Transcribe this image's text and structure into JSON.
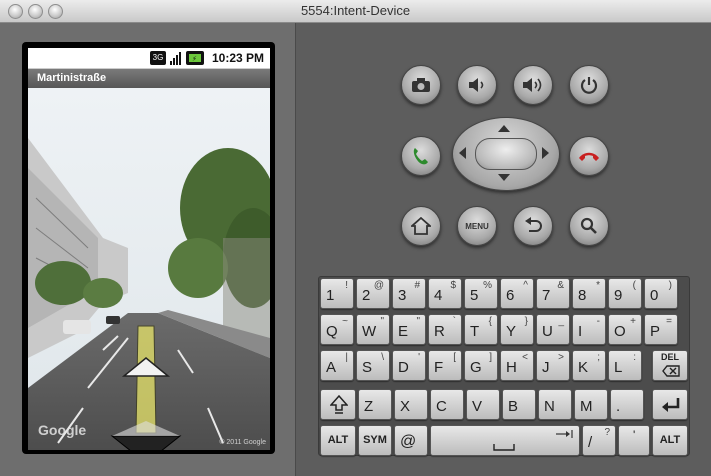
{
  "window": {
    "title": "5554:Intent-Device"
  },
  "phone": {
    "status": {
      "network": "3G",
      "time": "10:23 PM"
    },
    "app_title": "Martinistraße",
    "watermark": "Google",
    "copyright": "© 2011 Google"
  },
  "controls": {
    "menu_label": "MENU"
  },
  "keyboard": {
    "row1": [
      {
        "p": "1",
        "s": "!"
      },
      {
        "p": "2",
        "s": "@"
      },
      {
        "p": "3",
        "s": "#"
      },
      {
        "p": "4",
        "s": "$"
      },
      {
        "p": "5",
        "s": "%"
      },
      {
        "p": "6",
        "s": "^"
      },
      {
        "p": "7",
        "s": "&"
      },
      {
        "p": "8",
        "s": "*"
      },
      {
        "p": "9",
        "s": "("
      },
      {
        "p": "0",
        "s": ")"
      }
    ],
    "row2": [
      {
        "p": "Q",
        "s": "~"
      },
      {
        "p": "W",
        "s": "\""
      },
      {
        "p": "E",
        "s": "\""
      },
      {
        "p": "R",
        "s": "`"
      },
      {
        "p": "T",
        "s": "{"
      },
      {
        "p": "Y",
        "s": "}"
      },
      {
        "p": "U",
        "s": "_"
      },
      {
        "p": "I",
        "s": "-"
      },
      {
        "p": "O",
        "s": "+"
      },
      {
        "p": "P",
        "s": "="
      }
    ],
    "row3": [
      {
        "p": "A",
        "s": "|"
      },
      {
        "p": "S",
        "s": "\\"
      },
      {
        "p": "D",
        "s": "'"
      },
      {
        "p": "F",
        "s": "["
      },
      {
        "p": "G",
        "s": "]"
      },
      {
        "p": "H",
        "s": "<"
      },
      {
        "p": "J",
        "s": ">"
      },
      {
        "p": "K",
        "s": ";"
      },
      {
        "p": "L",
        "s": ":"
      }
    ],
    "del_label": "DEL",
    "row4": [
      {
        "p": "Z",
        "s": ""
      },
      {
        "p": "X",
        "s": ""
      },
      {
        "p": "C",
        "s": ""
      },
      {
        "p": "V",
        "s": ""
      },
      {
        "p": "B",
        "s": ""
      },
      {
        "p": "N",
        "s": ""
      },
      {
        "p": "M",
        "s": ""
      },
      {
        "p": ".",
        "s": ""
      }
    ],
    "alt_label": "ALT",
    "sym_label": "SYM",
    "at_label": "@",
    "slash": {
      "p": "/",
      "s": "?"
    }
  }
}
